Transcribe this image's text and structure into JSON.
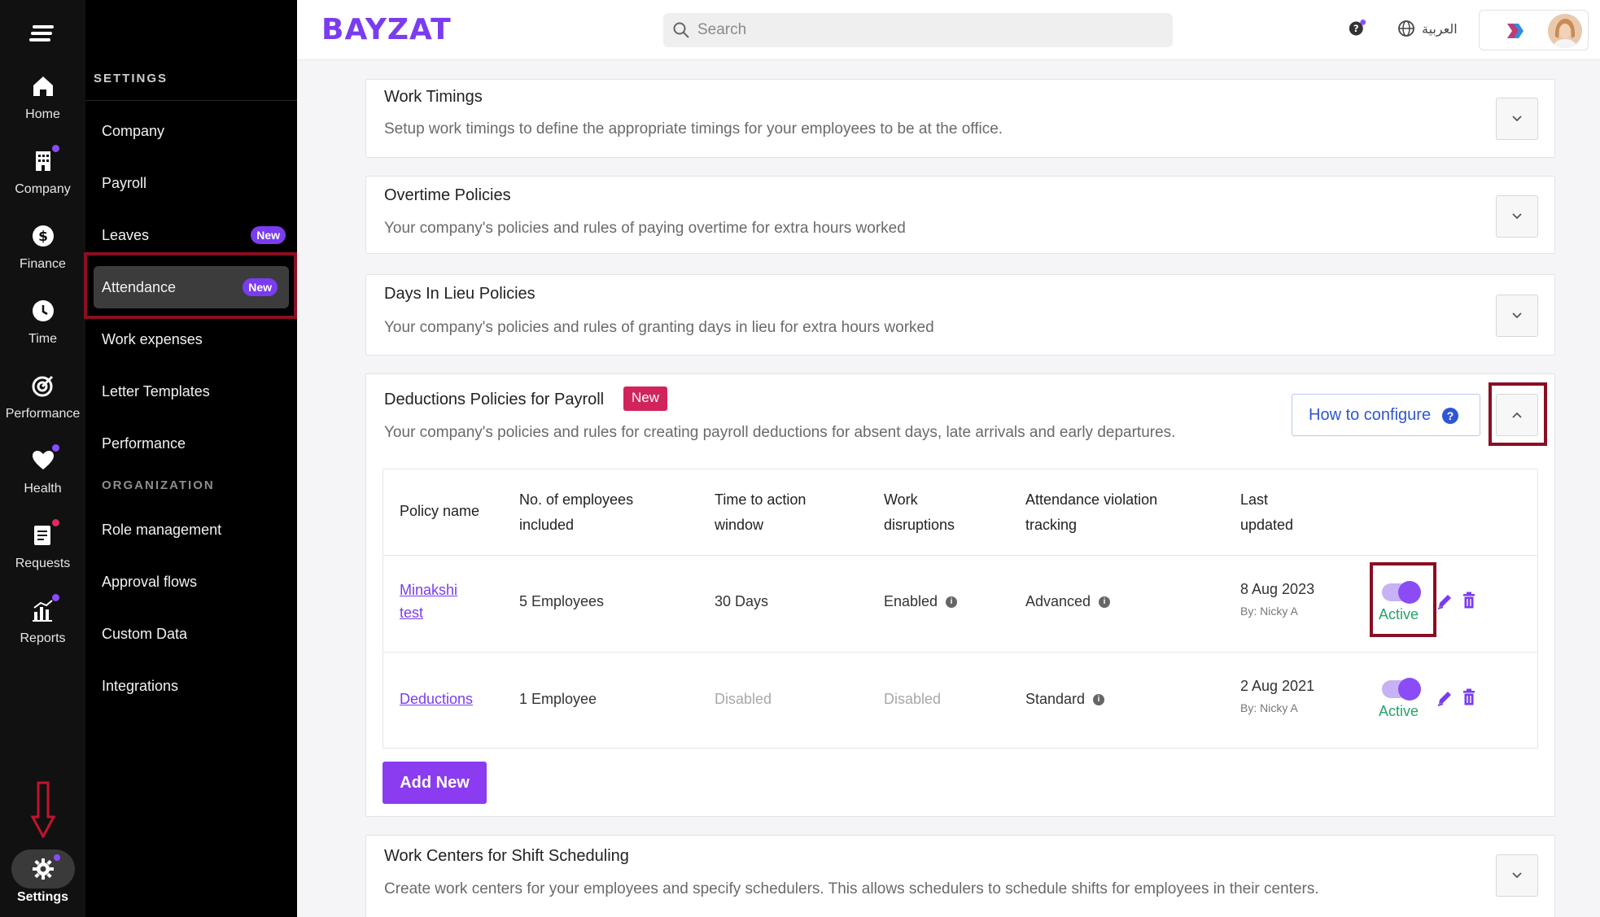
{
  "rail": {
    "items": [
      {
        "label": "Home",
        "icon": "home-icon"
      },
      {
        "label": "Company",
        "icon": "building-icon"
      },
      {
        "label": "Finance",
        "icon": "dollar-icon"
      },
      {
        "label": "Time",
        "icon": "clock-icon"
      },
      {
        "label": "Performance",
        "icon": "target-icon"
      },
      {
        "label": "Health",
        "icon": "heart-icon"
      },
      {
        "label": "Requests",
        "icon": "clipboard-icon"
      },
      {
        "label": "Reports",
        "icon": "chart-icon"
      }
    ],
    "settings_label": "Settings"
  },
  "sidebar": {
    "heading": "SETTINGS",
    "items": [
      {
        "label": "Company"
      },
      {
        "label": "Payroll"
      },
      {
        "label": "Leaves",
        "badge": "New"
      },
      {
        "label": "Attendance",
        "badge": "New"
      },
      {
        "label": "Work expenses"
      },
      {
        "label": "Letter Templates"
      },
      {
        "label": "Performance"
      }
    ],
    "org_heading": "ORGANIZATION",
    "org_items": [
      {
        "label": "Role management"
      },
      {
        "label": "Approval flows"
      },
      {
        "label": "Custom Data"
      },
      {
        "label": "Integrations"
      }
    ]
  },
  "header": {
    "logo": "BAYZAT",
    "search_placeholder": "Search",
    "language": "العربية"
  },
  "sections": [
    {
      "title": "Work Timings",
      "desc": "Setup work timings to define the appropriate timings for your employees to be at the office."
    },
    {
      "title": "Overtime Policies",
      "desc": "Your company's policies and rules of paying overtime for extra hours worked"
    },
    {
      "title": "Days In Lieu Policies",
      "desc": "Your company's policies and rules of granting days in lieu for extra hours worked"
    },
    {
      "title": "Work Centers for Shift Scheduling",
      "desc": "Create work centers for your employees and specify schedulers. This allows schedulers to schedule shifts for employees in their centers."
    }
  ],
  "deductions": {
    "title": "Deductions Policies for Payroll",
    "badge": "New",
    "desc": "Your company's policies and rules for creating payroll deductions for absent days, late arrivals and early departures.",
    "how_to": "How to configure",
    "columns": [
      {
        "line1": "Policy name",
        "line2": ""
      },
      {
        "line1": "No. of employees",
        "line2": "included"
      },
      {
        "line1": "Time to action",
        "line2": "window"
      },
      {
        "line1": "Work",
        "line2": "disruptions"
      },
      {
        "line1": "Attendance violation",
        "line2": "tracking"
      },
      {
        "line1": "Last",
        "line2": "updated"
      }
    ],
    "rows": [
      {
        "name_l1": "Minakshi",
        "name_l2": "test",
        "employees": "5 Employees",
        "window": "30 Days",
        "disruptions": "Enabled",
        "tracking": "Advanced",
        "date": "8 Aug 2023",
        "by": "By: Nicky A",
        "status": "Active"
      },
      {
        "name_l1": "Deductions",
        "name_l2": "",
        "employees": "1 Employee",
        "window": "Disabled",
        "disruptions": "Disabled",
        "tracking": "Standard",
        "date": "2 Aug 2021",
        "by": "By: Nicky A",
        "status": "Active"
      }
    ],
    "add_new": "Add New"
  },
  "colors": {
    "accent": "#7a3cf0",
    "new_badge": "#d1245b",
    "active_green": "#27a36a",
    "highlight_red": "#8b0e22"
  }
}
